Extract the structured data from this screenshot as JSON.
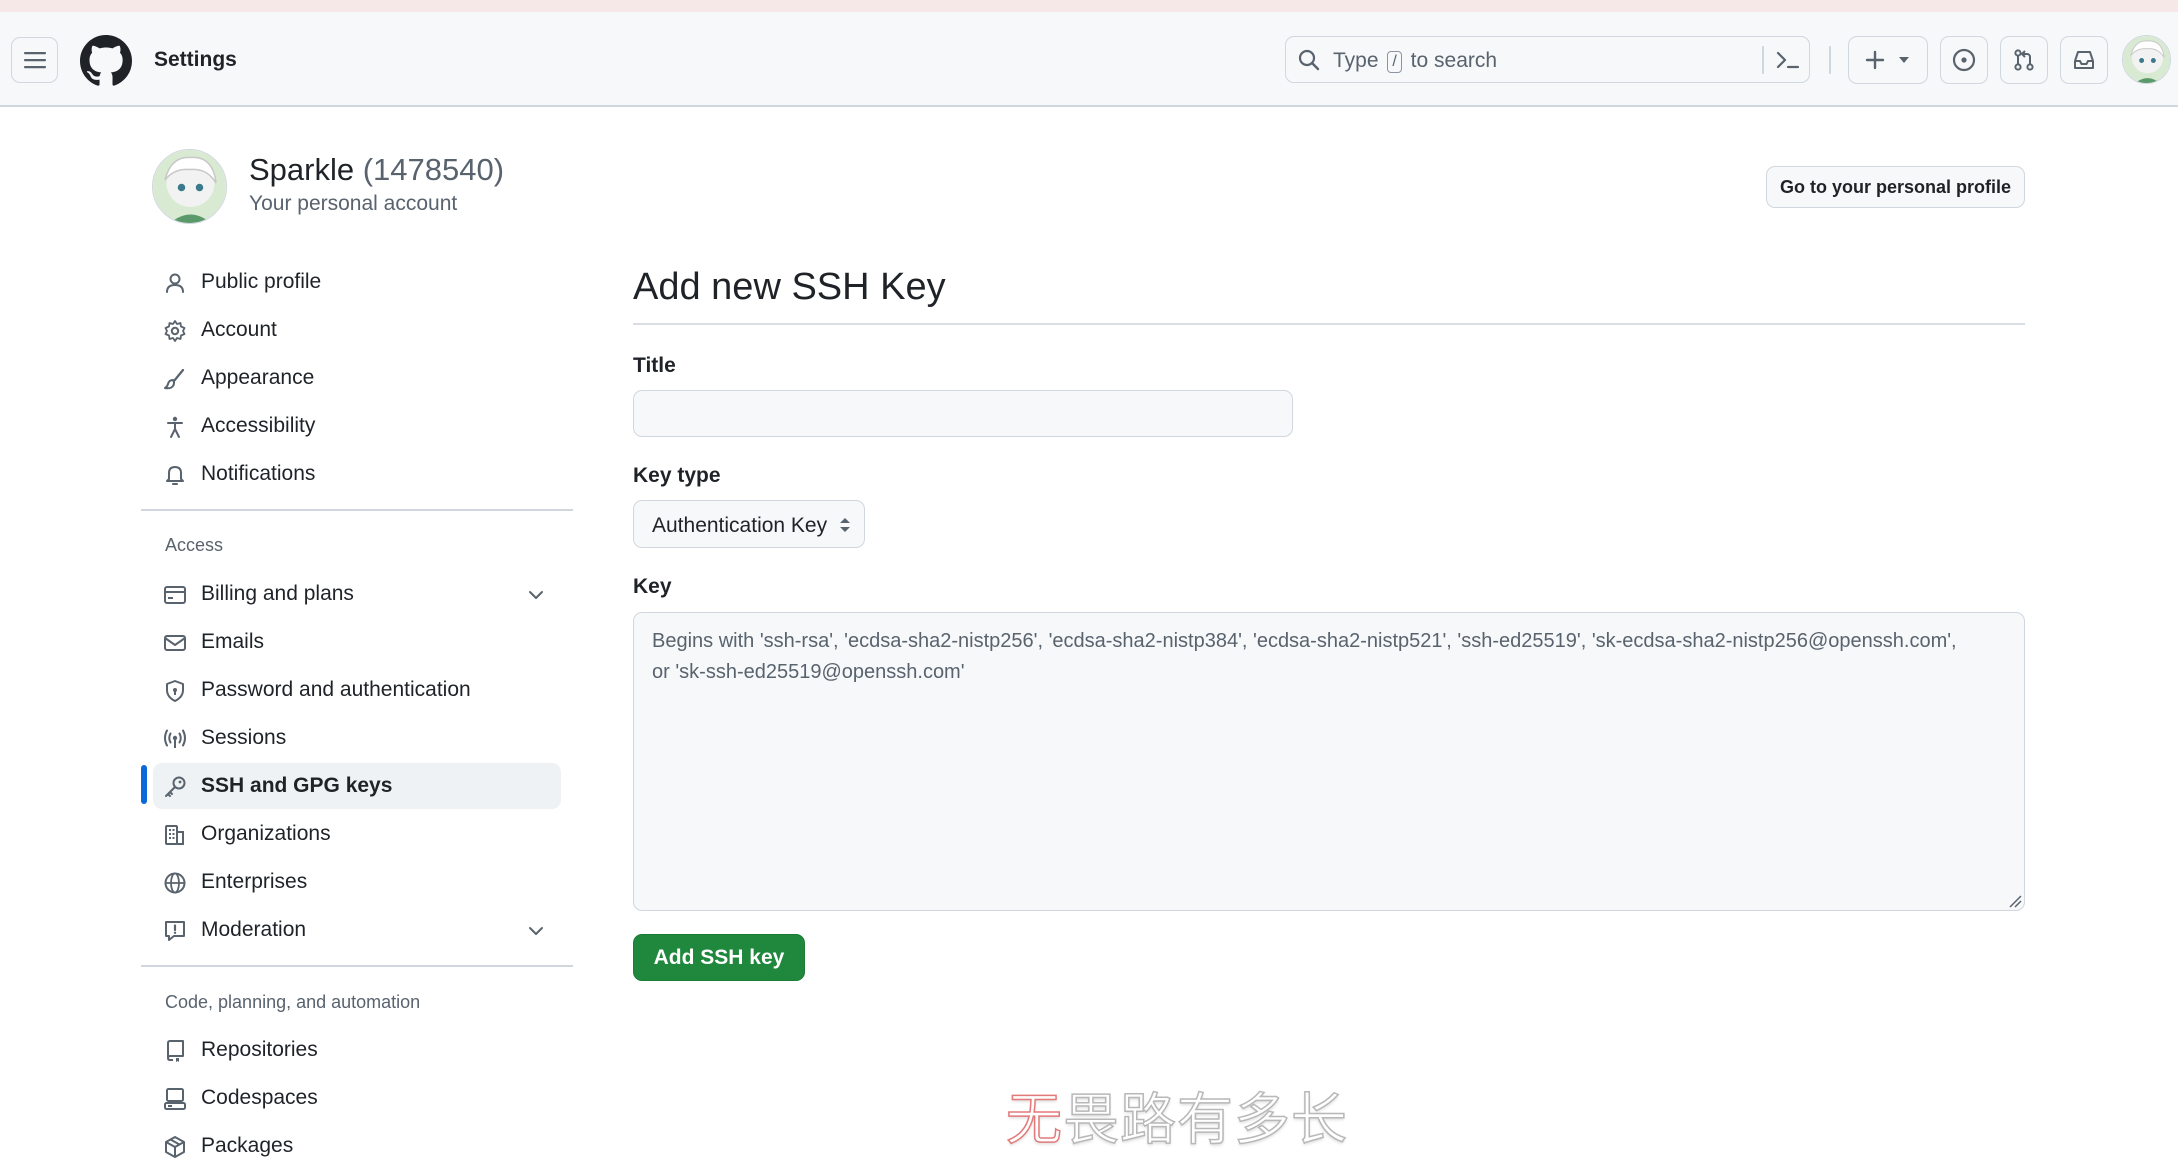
{
  "header": {
    "context_title": "Settings",
    "search": {
      "prefix": "Type",
      "key": "/",
      "suffix": "to search"
    }
  },
  "account": {
    "name": "Sparkle",
    "id": "(1478540)",
    "subtitle": "Your personal account",
    "profile_button": "Go to your personal profile"
  },
  "sidebar": {
    "items": [
      {
        "label": "Public profile",
        "icon": "person-icon"
      },
      {
        "label": "Account",
        "icon": "gear-icon"
      },
      {
        "label": "Appearance",
        "icon": "paintbrush-icon"
      },
      {
        "label": "Accessibility",
        "icon": "accessibility-icon"
      },
      {
        "label": "Notifications",
        "icon": "bell-icon"
      }
    ],
    "access_heading": "Access",
    "access_items": [
      {
        "label": "Billing and plans",
        "icon": "credit-card-icon"
      },
      {
        "label": "Emails",
        "icon": "mail-icon"
      },
      {
        "label": "Password and authentication",
        "icon": "shield-lock-icon"
      },
      {
        "label": "Sessions",
        "icon": "broadcast-icon"
      },
      {
        "label": "SSH and GPG keys",
        "icon": "key-icon",
        "active": true
      },
      {
        "label": "Organizations",
        "icon": "organization-icon"
      },
      {
        "label": "Enterprises",
        "icon": "globe-icon"
      },
      {
        "label": "Moderation",
        "icon": "report-icon"
      }
    ],
    "code_heading": "Code, planning, and automation",
    "code_items": [
      {
        "label": "Repositories",
        "icon": "repo-icon"
      },
      {
        "label": "Codespaces",
        "icon": "codespaces-icon"
      },
      {
        "label": "Packages",
        "icon": "package-icon"
      }
    ]
  },
  "main": {
    "title": "Add new SSH Key",
    "title_label": "Title",
    "title_value": "",
    "key_type_label": "Key type",
    "key_type_value": "Authentication Key",
    "key_label": "Key",
    "key_placeholder_line1": "Begins with 'ssh-rsa', 'ecdsa-sha2-nistp256', 'ecdsa-sha2-nistp384', 'ecdsa-sha2-nistp521', 'ssh-ed25519', 'sk-ecdsa-sha2-nistp256@openssh.com',",
    "key_placeholder_line2": "or 'sk-ssh-ed25519@openssh.com'",
    "submit_label": "Add SSH key"
  },
  "watermark": {
    "first_char": "无",
    "rest": "畏路有多长"
  },
  "colors": {
    "accent": "#0969da",
    "primary_button": "#1f883d",
    "muted_text": "#59636e",
    "border": "#d0d7de"
  }
}
